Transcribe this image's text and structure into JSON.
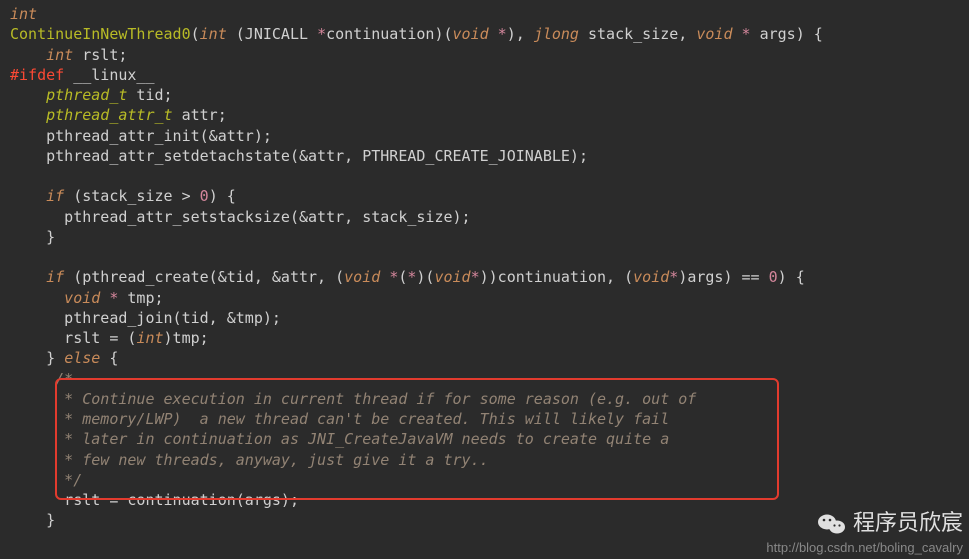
{
  "code": {
    "l01_int": "int",
    "l02_fn": "ContinueInNewThread0",
    "l02_p1_int": "int",
    "l02_jnicall": " (JNICALL ",
    "l02_star1": "*",
    "l02_cont": "continuation)(",
    "l02_void1": "void",
    "l02_star2": " *",
    "l02_close1": "), ",
    "l02_jlong": "jlong",
    "l02_ss": " stack_size, ",
    "l02_void2": "void",
    "l02_star3": " * ",
    "l02_args": "args) {",
    "l03": "    int",
    "l03b": " rslt;",
    "l04_def": "#ifdef",
    "l04_mac": " __linux__",
    "l05_t": "    pthread_t",
    "l05b": " tid;",
    "l06_t": "    pthread_attr_t",
    "l06b": " attr;",
    "l07": "    pthread_attr_init(&attr);",
    "l08": "    pthread_attr_setdetachstate(&attr, PTHREAD_CREATE_JOINABLE);",
    "l09": "",
    "l10_if": "    if",
    "l10_cond": " (stack_size > ",
    "l10_zero": "0",
    "l10_end": ") {",
    "l11": "      pthread_attr_setstacksize(&attr, stack_size);",
    "l12": "    }",
    "l13": "",
    "l14_if": "    if",
    "l14_a": " (pthread_create(&tid, &attr, (",
    "l14_void1": "void",
    "l14_b": " ",
    "l14_s1": "*",
    "l14_c": "(",
    "l14_s2": "*",
    "l14_d": ")(",
    "l14_void2": "void",
    "l14_s3": "*",
    "l14_e": "))continuation, (",
    "l14_void3": "void",
    "l14_s4": "*",
    "l14_f": ")args) == ",
    "l14_zero": "0",
    "l14_g": ") {",
    "l15_a": "      void",
    "l15_b": " ",
    "l15_s": "*",
    "l15_c": " tmp;",
    "l16": "      pthread_join(tid, &tmp);",
    "l17_a": "      rslt = (",
    "l17_int": "int",
    "l17_b": ")tmp;",
    "l18_a": "    } ",
    "l18_else": "else",
    "l18_b": " {",
    "c1": "     /*",
    "c2": "      * Continue execution in current thread if for some reason (e.g. out of",
    "c3": "      * memory/LWP)  a new thread can't be created. This will likely fail",
    "c4": "      * later in continuation as JNI_CreateJavaVM needs to create quite a",
    "c5": "      * few new threads, anyway, just give it a try..",
    "c6": "      */",
    "l25": "      rslt = continuation(args);",
    "l26": "    }"
  },
  "watermark": {
    "cn": "程序员欣宸",
    "url": "http://blog.csdn.net/boling_cavalry"
  }
}
